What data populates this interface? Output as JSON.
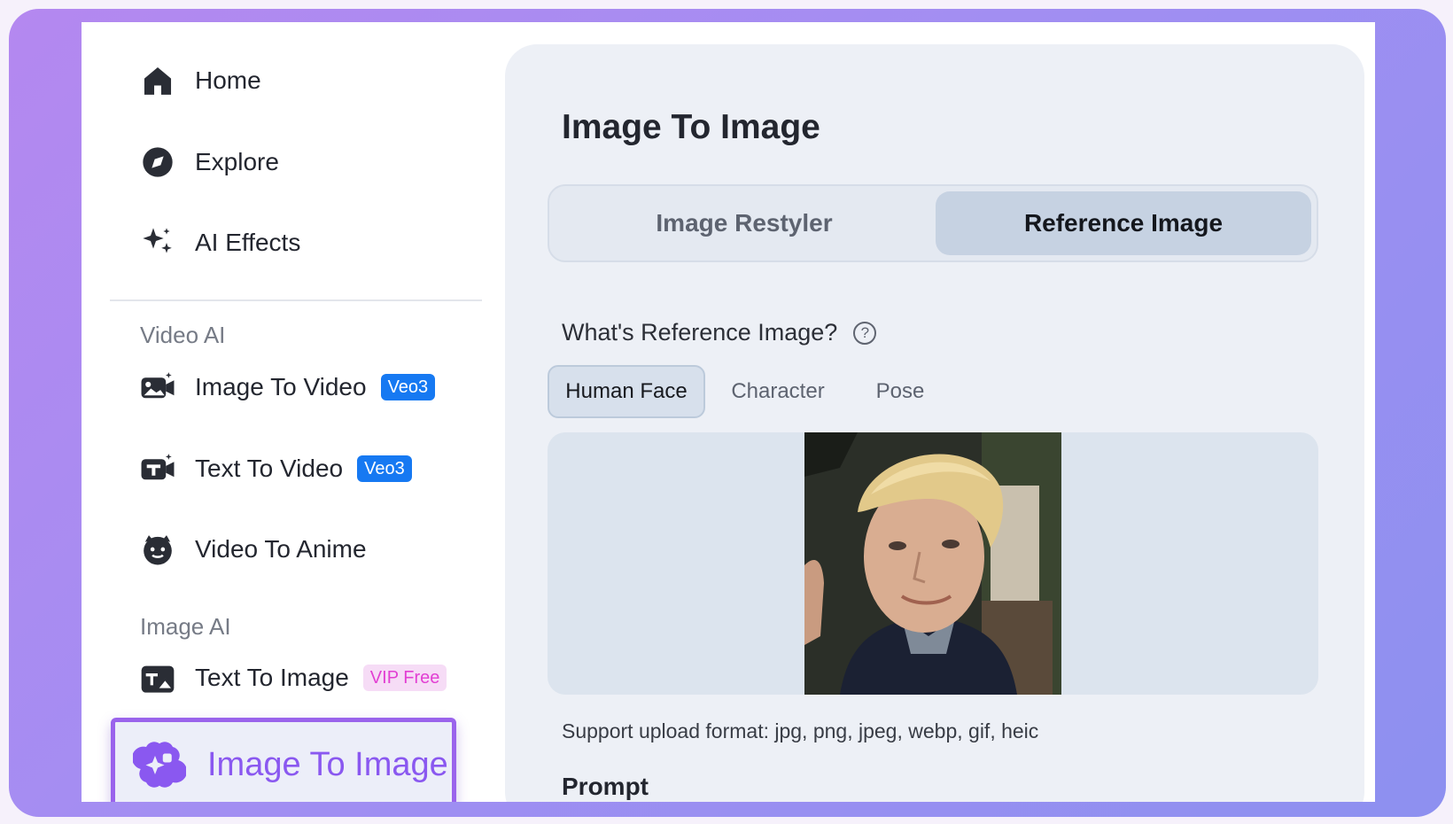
{
  "sidebar": {
    "home": "Home",
    "explore": "Explore",
    "ai_effects": "AI Effects",
    "video_ai_label": "Video AI",
    "image_to_video": "Image To Video",
    "image_to_video_badge": "Veo3",
    "text_to_video": "Text To Video",
    "text_to_video_badge": "Veo3",
    "video_to_anime": "Video To Anime",
    "image_ai_label": "Image AI",
    "text_to_image": "Text To Image",
    "text_to_image_badge": "VIP Free",
    "image_to_image": "Image To Image"
  },
  "main": {
    "title": "Image To Image",
    "modes": [
      "Image Restyler",
      "Reference Image"
    ],
    "active_mode": "Reference Image",
    "question": "What's Reference Image?",
    "reference_types": [
      "Human Face",
      "Character",
      "Pose"
    ],
    "active_reference_type": "Human Face",
    "support_text": "Support upload format: jpg, png, jpeg, webp, gif, heic",
    "prompt_label": "Prompt"
  },
  "colors": {
    "accent_purple": "#9a63ec",
    "badge_blue": "#1679f2",
    "vip_pink": "#e23fd3"
  }
}
